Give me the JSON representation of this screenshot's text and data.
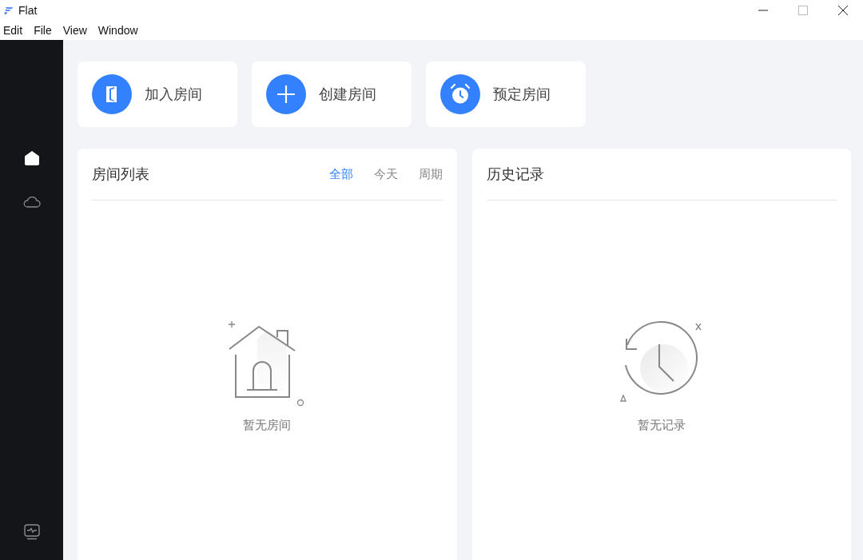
{
  "window": {
    "title": "Flat"
  },
  "menu": [
    "Edit",
    "File",
    "View",
    "Window"
  ],
  "sidebar": {
    "items": [
      {
        "kind": "home",
        "selected": true
      },
      {
        "kind": "cloud",
        "selected": false
      }
    ]
  },
  "actions": [
    {
      "kind": "join",
      "label": "加入房间"
    },
    {
      "kind": "create",
      "label": "创建房间"
    },
    {
      "kind": "schedule",
      "label": "预定房间"
    }
  ],
  "room_list": {
    "title": "房间列表",
    "filters": [
      {
        "label": "全部",
        "selected": true
      },
      {
        "label": "今天",
        "selected": false
      },
      {
        "label": "周期",
        "selected": false
      }
    ],
    "empty": "暂无房间"
  },
  "history": {
    "title": "历史记录",
    "empty": "暂无记录"
  }
}
